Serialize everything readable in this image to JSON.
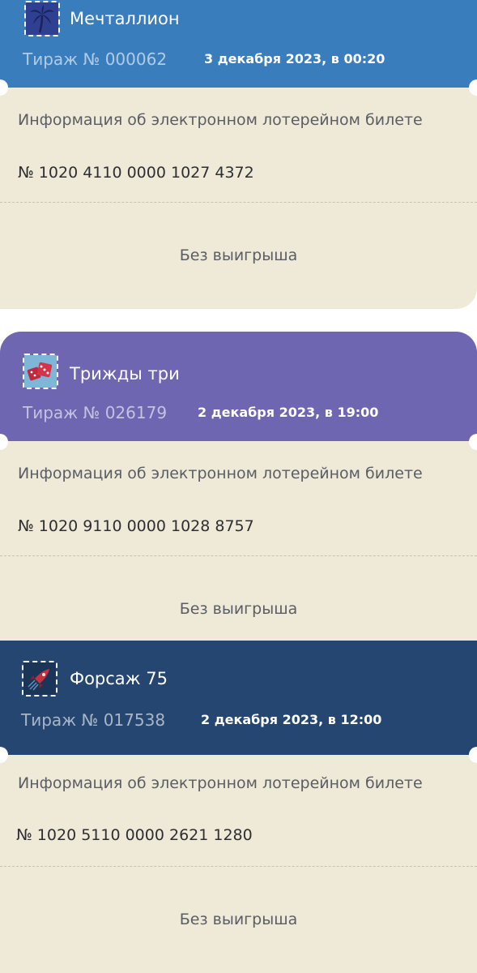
{
  "colors": {
    "mechtallion": "#3a7dbd",
    "trizhdy_tri": "#6e66b0",
    "forsazh": "#244671",
    "ticket_body": "#efe9d7"
  },
  "tickets": [
    {
      "game": "Мечталлион",
      "logo_icon": "palm-tree-icon",
      "draw": "Тираж № 000062",
      "date": "3 декабря 2023, в 00:20",
      "info_title": "Информация об электронном лотерейном билете",
      "number": "№ 1020 4110 0000 1027 4372",
      "result": "Без выигрыша"
    },
    {
      "game": "Трижды три",
      "logo_icon": "dice-icon",
      "draw": "Тираж № 026179",
      "date": "2 декабря 2023, в 19:00",
      "info_title": "Информация об электронном лотерейном билете",
      "number": "№ 1020 9110 0000 1028 8757",
      "result": "Без выигрыша"
    },
    {
      "game": "Форсаж 75",
      "logo_icon": "rocket-icon",
      "draw": "Тираж № 017538",
      "date": "2 декабря 2023, в 12:00",
      "info_title": "Информация об электронном лотерейном билете",
      "number": "№ 1020 5110 0000 2621 1280",
      "result": "Без выигрыша"
    }
  ]
}
